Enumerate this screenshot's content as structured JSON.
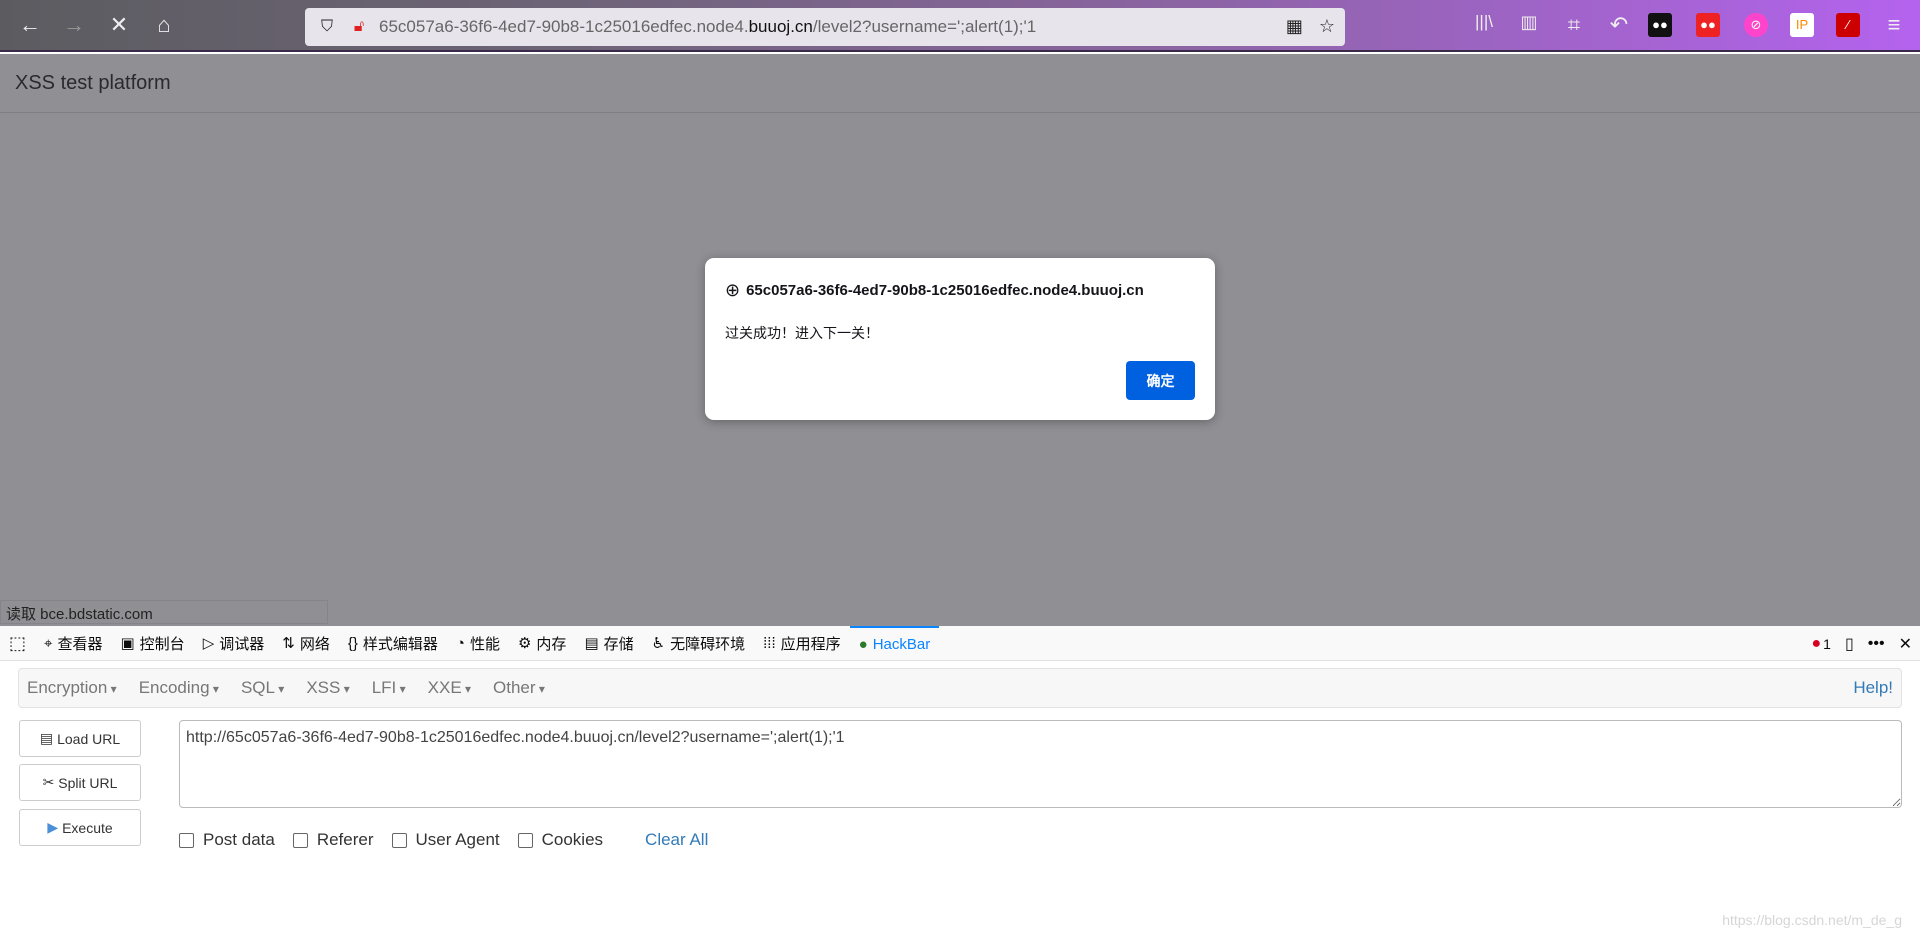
{
  "browser": {
    "url_prefix": "65c057a6-36f6-4ed7-90b8-1c25016edfec.node4.",
    "url_domain": "buuoj.cn",
    "url_suffix": "/level2?username=';alert(1);'1",
    "accent": "#b463ee"
  },
  "page": {
    "title": "XSS test platform",
    "status": "读取 bce.bdstatic.com"
  },
  "dialog": {
    "host": "65c057a6-36f6-4ed7-90b8-1c25016edfec.node4.buuoj.cn",
    "message": "过关成功！进入下一关！",
    "ok_label": "确定",
    "button_color": "#0061e0"
  },
  "devtools": {
    "tabs": [
      {
        "label": "查看器",
        "icon": "inspector-icon"
      },
      {
        "label": "控制台",
        "icon": "console-icon"
      },
      {
        "label": "调试器",
        "icon": "debugger-icon"
      },
      {
        "label": "网络",
        "icon": "network-icon"
      },
      {
        "label": "样式编辑器",
        "icon": "style-editor-icon"
      },
      {
        "label": "性能",
        "icon": "performance-icon"
      },
      {
        "label": "内存",
        "icon": "memory-icon"
      },
      {
        "label": "存储",
        "icon": "storage-icon"
      },
      {
        "label": "无障碍环境",
        "icon": "accessibility-icon"
      },
      {
        "label": "应用程序",
        "icon": "application-icon"
      },
      {
        "label": "HackBar",
        "icon": "hackbar-icon"
      }
    ],
    "error_count": "1"
  },
  "hackbar": {
    "menu": [
      "Encryption",
      "Encoding",
      "SQL",
      "XSS",
      "LFI",
      "XXE",
      "Other"
    ],
    "help": "Help!",
    "load_url": "Load URL",
    "split_url": "Split URL",
    "execute": "Execute",
    "url_value": "http://65c057a6-36f6-4ed7-90b8-1c25016edfec.node4.buuoj.cn/level2?username=';alert(1);'1",
    "options": [
      "Post data",
      "Referer",
      "User Agent",
      "Cookies"
    ],
    "clear_all": "Clear All"
  },
  "watermark": "https://blog.csdn.net/m_de_g"
}
